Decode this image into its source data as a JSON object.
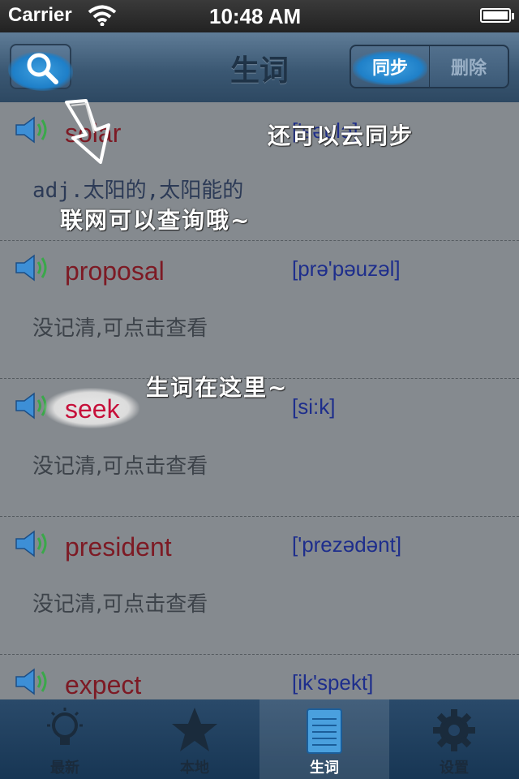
{
  "status_bar": {
    "carrier": "Carrier",
    "time": "10:48 AM"
  },
  "nav": {
    "title": "生词",
    "segments": [
      {
        "label": "同步",
        "selected": true
      },
      {
        "label": "删除",
        "selected": false
      }
    ]
  },
  "words": [
    {
      "word": "solar",
      "phonetic": "['səulə]",
      "definition": "adj.太阳的,太阳能的"
    },
    {
      "word": "proposal",
      "phonetic": "[prə'pəuzəl]",
      "definition": "没记清,可点击查看"
    },
    {
      "word": "seek",
      "phonetic": "[si:k]",
      "definition": "没记清,可点击查看"
    },
    {
      "word": "president",
      "phonetic": "['prezədənt]",
      "definition": "没记清,可点击查看"
    },
    {
      "word": "expect",
      "phonetic": "[ik'spekt]",
      "definition": ""
    }
  ],
  "annotations": {
    "sync_note": "还可以云同步",
    "lookup_note": "联网可以查询哦~",
    "here_note": "生词在这里~"
  },
  "tabs": [
    {
      "label": "最新",
      "icon": "lightbulb-icon",
      "active": false
    },
    {
      "label": "本地",
      "icon": "star-icon",
      "active": false
    },
    {
      "label": "生词",
      "icon": "notepad-icon",
      "active": true
    },
    {
      "label": "设置",
      "icon": "gear-icon",
      "active": false
    }
  ],
  "colors": {
    "word": "#7d1a24",
    "word_highlighted": "#c6103a",
    "phonetic": "#1e2e8c",
    "accent_blue": "#1f80c8"
  }
}
